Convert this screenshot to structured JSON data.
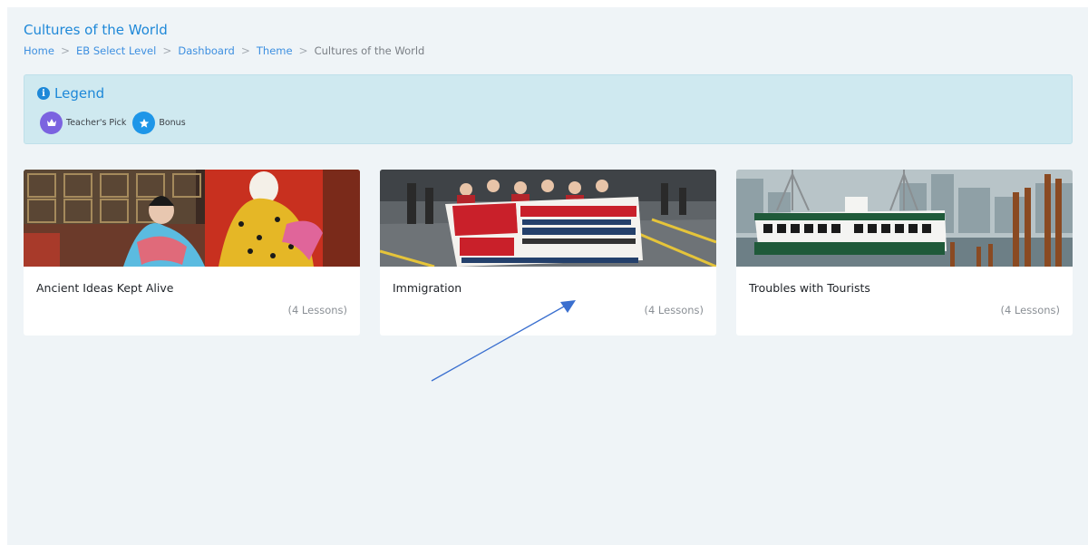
{
  "page": {
    "title": "Cultures of the World"
  },
  "breadcrumb": {
    "items": [
      "Home",
      "EB Select Level",
      "Dashboard",
      "Theme"
    ],
    "current": "Cultures of the World"
  },
  "legend": {
    "title": "Legend",
    "items": [
      {
        "label": "Teacher's Pick",
        "icon": "crown-icon",
        "color": "#7b63e0"
      },
      {
        "label": "Bonus",
        "icon": "star-icon",
        "color": "#1e96e8"
      }
    ]
  },
  "cards": [
    {
      "title": "Ancient Ideas Kept Alive",
      "lessons": "(4 Lessons)",
      "image": "chinese-opera-performers-photo"
    },
    {
      "title": "Immigration",
      "lessons": "(4 Lessons)",
      "image": "protest-march-photo"
    },
    {
      "title": "Troubles with Tourists",
      "lessons": "(4 Lessons)",
      "image": "harbor-ferry-photo"
    }
  ],
  "colors": {
    "accent": "#1e88d8",
    "legend_bg": "#cfe9f0",
    "page_bg": "#eff4f7",
    "annotation_arrow": "#3a6fcf"
  }
}
